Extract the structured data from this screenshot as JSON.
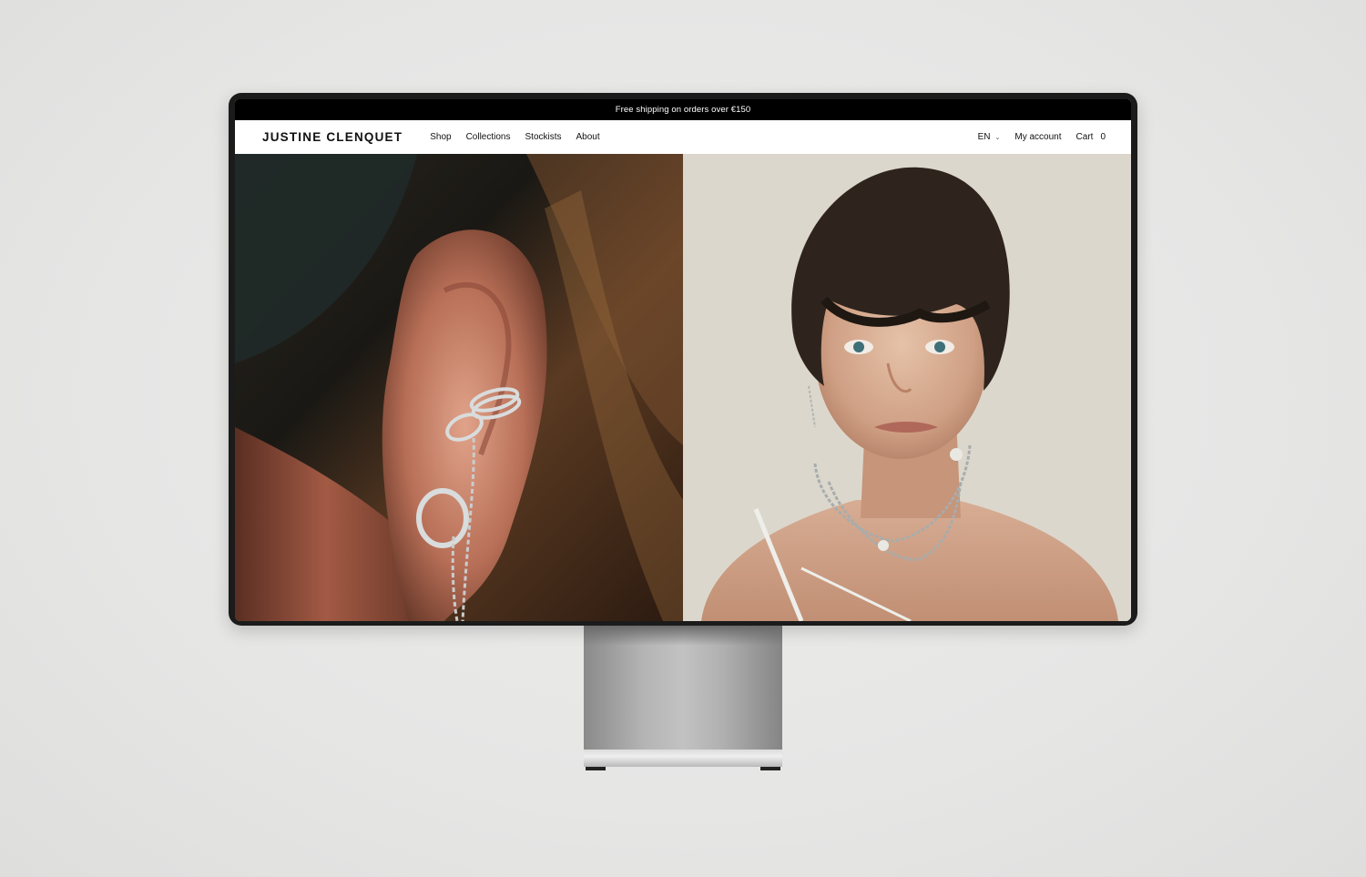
{
  "announcement": {
    "text": "Free shipping on orders over €150"
  },
  "header": {
    "logo": "JUSTINE CLENQUET",
    "nav": {
      "shop": "Shop",
      "collections": "Collections",
      "stockists": "Stockists",
      "about": "About"
    },
    "language": "EN",
    "account": "My account",
    "cart_label": "Cart",
    "cart_count": "0"
  },
  "hero": {
    "left_image": "ear-cuffs-closeup-photo",
    "right_image": "model-portrait-necklace-photo"
  },
  "colors": {
    "announcement_bg": "#000000",
    "nav_bg": "#ffffff",
    "text": "#111111",
    "backdrop": "#e8e8e7"
  }
}
